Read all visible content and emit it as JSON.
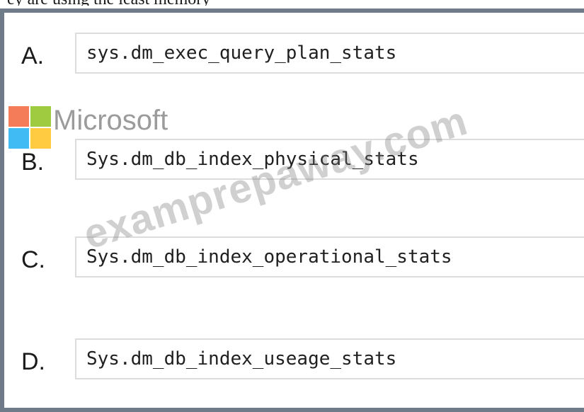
{
  "caption": "ey are using the least memory",
  "options": [
    {
      "letter": "A.",
      "text": "sys.dm_exec_query_plan_stats"
    },
    {
      "letter": "B.",
      "text": "Sys.dm_db_index_physical_stats"
    },
    {
      "letter": "C.",
      "text": "Sys.dm_db_index_operational_stats"
    },
    {
      "letter": "D.",
      "text": "Sys.dm_db_index_useage_stats"
    }
  ],
  "watermark": {
    "logo_text": "Microsoft",
    "site_text": "examprepaway.com",
    "logo_colors": [
      "#f25022",
      "#7fba00",
      "#00a4ef",
      "#ffb900"
    ]
  }
}
